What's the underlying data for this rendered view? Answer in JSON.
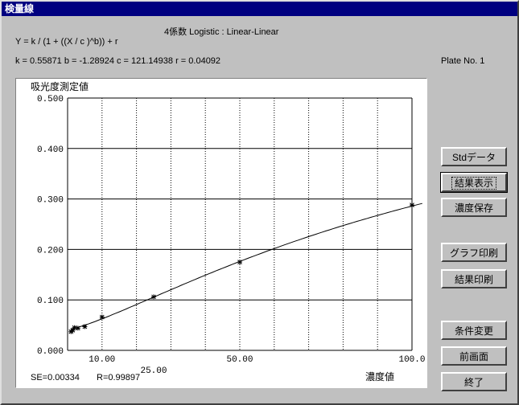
{
  "window": {
    "title": "検量線"
  },
  "info": {
    "model": "4係数  Logistic :  Linear-Linear",
    "equation": "Y = k / (1 + ((X / c )^b)) + r",
    "params": "k = 0.55871  b = -1.28924  c = 121.14938  r = 0.04092",
    "plate": "Plate No. 1"
  },
  "plot": {
    "ylabel": "吸光度測定値",
    "xlabel": "濃度値",
    "se": "SE=0.00334",
    "r": "R=0.99897"
  },
  "buttons": {
    "std_data": "Stdデータ",
    "show_results": "結果表示",
    "save_conc": "濃度保存",
    "print_graph": "グラフ印刷",
    "print_results": "結果印刷",
    "change_conditions": "条件変更",
    "previous_screen": "前画面",
    "exit": "終了"
  },
  "chart_data": {
    "type": "scatter",
    "ylim": [
      0,
      0.5
    ],
    "xlim": [
      0,
      100
    ],
    "yticks": [
      "0.000",
      "0.100",
      "0.200",
      "0.300",
      "0.400",
      "0.500"
    ],
    "xticks": [
      "10.00",
      "25.00",
      "50.00",
      "100.0"
    ],
    "grid": true,
    "points": [
      [
        1,
        0.037
      ],
      [
        1.5,
        0.04
      ],
      [
        2,
        0.045
      ],
      [
        3,
        0.044
      ],
      [
        5,
        0.047
      ],
      [
        10,
        0.066
      ],
      [
        25,
        0.106
      ],
      [
        50,
        0.175
      ],
      [
        100,
        0.288
      ]
    ],
    "curve": {
      "k": 0.55871,
      "b": -1.28924,
      "c": 121.14938,
      "r": 0.04092
    }
  }
}
